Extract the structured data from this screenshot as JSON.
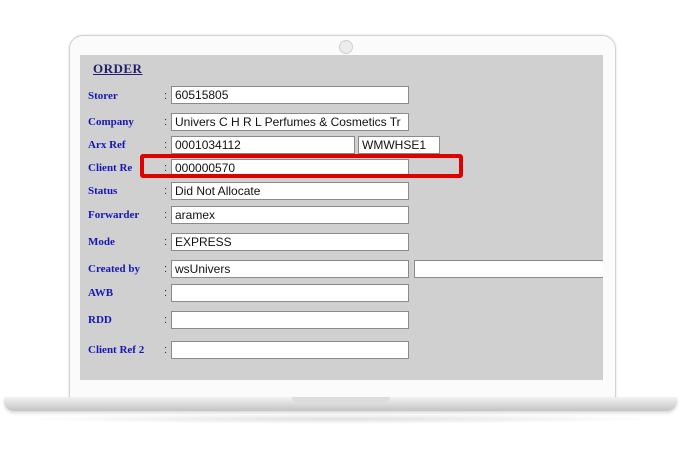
{
  "form": {
    "title": "ORDER",
    "rows": [
      {
        "label": "Storer",
        "value": "60515805"
      },
      {
        "label": "Company",
        "value": "Univers C H R L Perfumes & Cosmetics Tr"
      },
      {
        "label": "Arx Ref",
        "value": "0001034112",
        "extra": "WMWHSE1"
      },
      {
        "label": "Client Re",
        "value": "000000570"
      },
      {
        "label": "Status",
        "value": "Did Not Allocate"
      },
      {
        "label": "Forwarder",
        "value": "aramex"
      },
      {
        "label": "Mode",
        "value": "EXPRESS"
      },
      {
        "label": "Created by",
        "value": "wsUnivers",
        "extra": ""
      },
      {
        "label": "AWB",
        "value": ""
      },
      {
        "label": "RDD",
        "value": ""
      },
      {
        "label": "Client Ref 2",
        "value": ""
      }
    ],
    "colon": ":"
  },
  "annotation": {
    "highlight_color": "#e00000"
  },
  "colors": {
    "label": "#1616b8",
    "title": "#1f1f6a",
    "screen_bg": "#d0d0d0"
  }
}
